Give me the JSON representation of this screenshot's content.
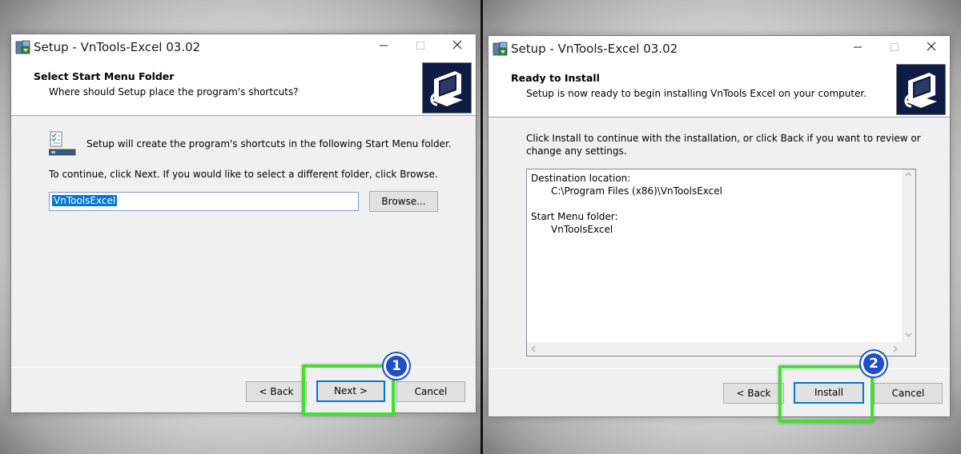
{
  "window_title": "Setup - VnTools-Excel 03.02",
  "left_dialog": {
    "header_title": "Select Start Menu Folder",
    "header_subtitle": "Where should Setup place the program's shortcuts?",
    "info_text": "Setup will create the program's shortcuts in the following Start Menu folder.",
    "continue_text": "To continue, click Next. If you would like to select a different folder, click Browse.",
    "folder_value": "VnToolsExcel",
    "browse_label": "Browse...",
    "back_label": "< Back",
    "next_label": "Next >",
    "cancel_label": "Cancel"
  },
  "right_dialog": {
    "header_title": "Ready to Install",
    "header_subtitle": "Setup is now ready to begin installing VnTools Excel on your computer.",
    "body_line1": "Click Install to continue with the installation, or click Back if you want to review or",
    "body_line2": "change any settings.",
    "memo": {
      "dest_label": "Destination location:",
      "dest_value": "C:\\Program Files (x86)\\VnToolsExcel",
      "start_label": "Start Menu folder:",
      "start_value": "VnToolsExcel"
    },
    "back_label": "< Back",
    "install_label": "Install",
    "cancel_label": "Cancel"
  },
  "annotations": {
    "badge1": "1",
    "badge2": "2",
    "highlight_color": "#3fe22b",
    "badge_color": "#1e4fcf"
  },
  "icons": {
    "window_controls": [
      "minimize-icon",
      "maximize-icon",
      "close-icon"
    ],
    "app": "installer-app-icon",
    "header_logo": "setup-computer-logo",
    "info": "start-menu-folder-icon"
  }
}
